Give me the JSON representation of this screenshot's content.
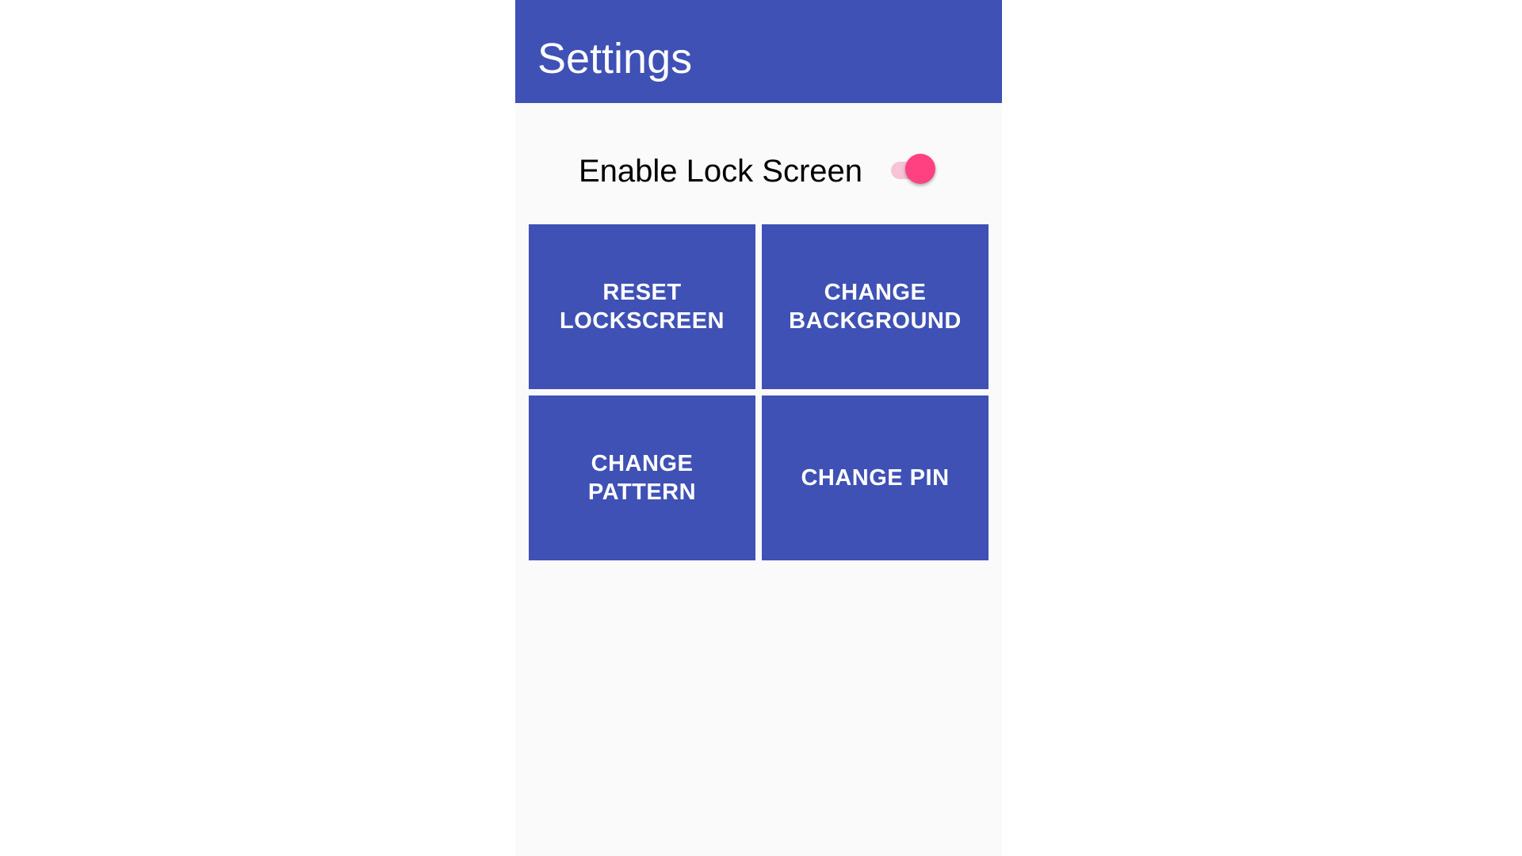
{
  "colors": {
    "primary": "#3f51b5",
    "accent": "#ff4081",
    "background": "#fafafa"
  },
  "appbar": {
    "title": "Settings"
  },
  "lock_screen": {
    "label": "Enable Lock Screen",
    "enabled": true
  },
  "buttons": {
    "reset_lockscreen": "RESET LOCKSCREEN",
    "change_background": "CHANGE BACKGROUND",
    "change_pattern": "CHANGE PATTERN",
    "change_pin": "CHANGE PIN"
  }
}
